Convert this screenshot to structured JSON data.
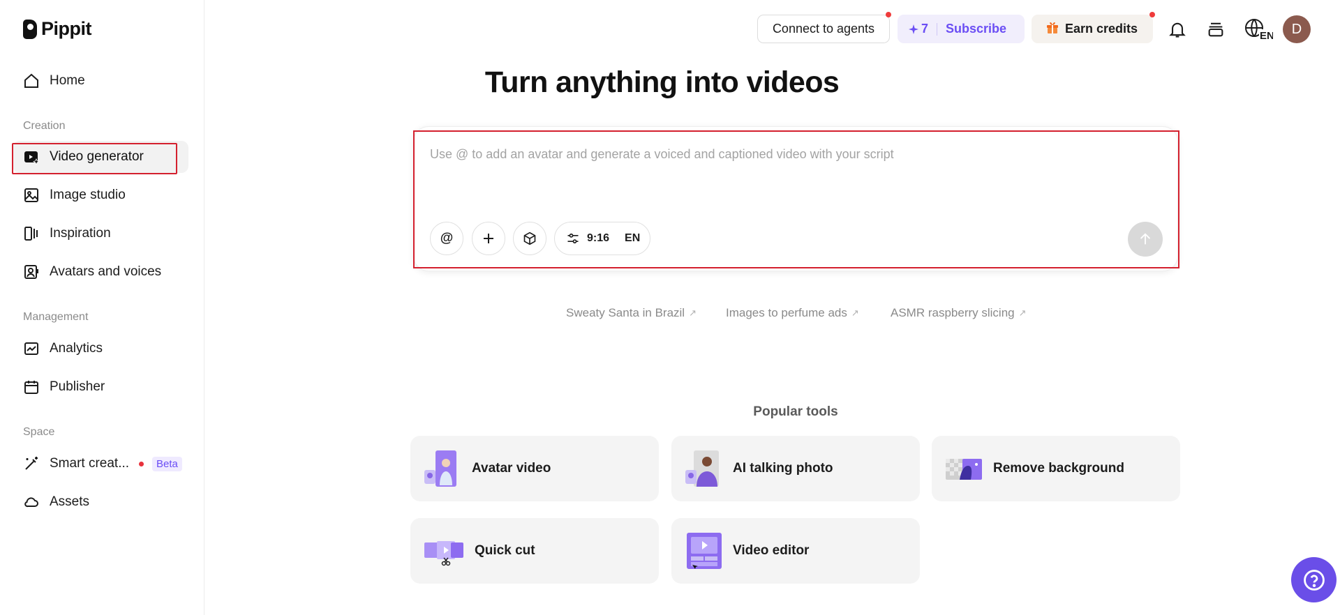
{
  "brand": {
    "name": "Pippit"
  },
  "sidebar": {
    "home": {
      "label": "Home",
      "icon": "home-icon"
    },
    "sections": {
      "creation": "Creation",
      "management": "Management",
      "space": "Space"
    },
    "creation_items": [
      {
        "label": "Video generator",
        "icon": "video-generator-icon",
        "active": true
      },
      {
        "label": "Image studio",
        "icon": "image-studio-icon"
      },
      {
        "label": "Inspiration",
        "icon": "inspiration-icon"
      },
      {
        "label": "Avatars and voices",
        "icon": "avatar-voice-icon"
      }
    ],
    "management_items": [
      {
        "label": "Analytics",
        "icon": "analytics-icon"
      },
      {
        "label": "Publisher",
        "icon": "calendar-icon"
      }
    ],
    "space_items": [
      {
        "label": "Smart creat...",
        "icon": "magic-wand-icon",
        "badge": "Beta"
      },
      {
        "label": "Assets",
        "icon": "cloud-icon"
      }
    ]
  },
  "header": {
    "connect_label": "Connect to agents",
    "credits_count": "7",
    "subscribe_label": "Subscribe",
    "earn_label": "Earn credits",
    "language_code": "EN",
    "avatar_initial": "D"
  },
  "main": {
    "title": "Turn anything into videos",
    "prompt": {
      "placeholder": "Use @ to add an avatar and generate a voiced and captioned video with your script",
      "value": "",
      "aspect_ratio": "9:16",
      "language": "EN"
    },
    "suggestions": [
      "Sweaty Santa in Brazil",
      "Images to perfume ads",
      "ASMR raspberry slicing"
    ],
    "popular_title": "Popular tools",
    "tools": [
      {
        "label": "Avatar video"
      },
      {
        "label": "AI talking photo"
      },
      {
        "label": "Remove background"
      },
      {
        "label": "Quick cut"
      },
      {
        "label": "Video editor"
      }
    ]
  },
  "colors": {
    "accent": "#6b4ef4",
    "highlight": "#d4202e",
    "notification": "#ef3b3b"
  }
}
